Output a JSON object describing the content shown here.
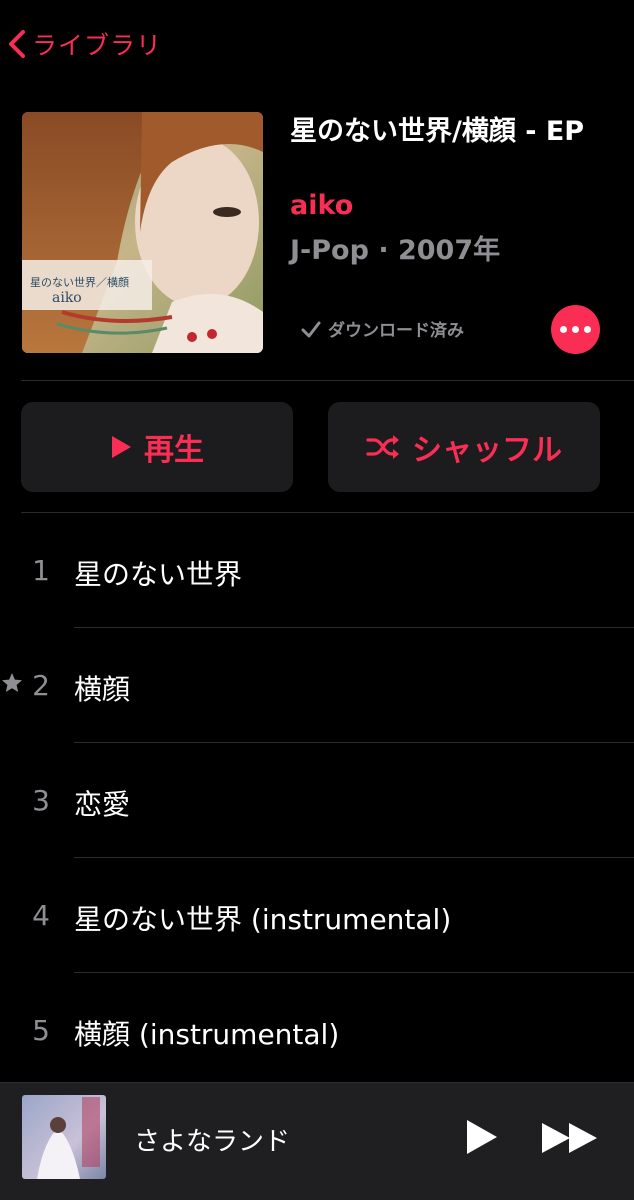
{
  "nav": {
    "back_label": "ライブラリ"
  },
  "album": {
    "title": "星のない世界/横顔 - EP",
    "artist": "aiko",
    "meta": "J-Pop · 2007年",
    "artwork_caption": "星のない世界／横顔",
    "artwork_artist": "aiko",
    "download_status": "ダウンロード済み"
  },
  "actions": {
    "play_label": "再生",
    "shuffle_label": "シャッフル"
  },
  "tracks": [
    {
      "number": "1",
      "title": "星のない世界",
      "starred": false
    },
    {
      "number": "2",
      "title": "横顔",
      "starred": true
    },
    {
      "number": "3",
      "title": "恋愛",
      "starred": false
    },
    {
      "number": "4",
      "title": "星のない世界 (instrumental)",
      "starred": false
    },
    {
      "number": "5",
      "title": "横顔 (instrumental)",
      "starred": false
    }
  ],
  "now_playing": {
    "title": "さよなランド"
  },
  "colors": {
    "accent": "#fa2d55",
    "secondary_text": "#8e8e93",
    "button_bg": "#1c1c1e"
  }
}
